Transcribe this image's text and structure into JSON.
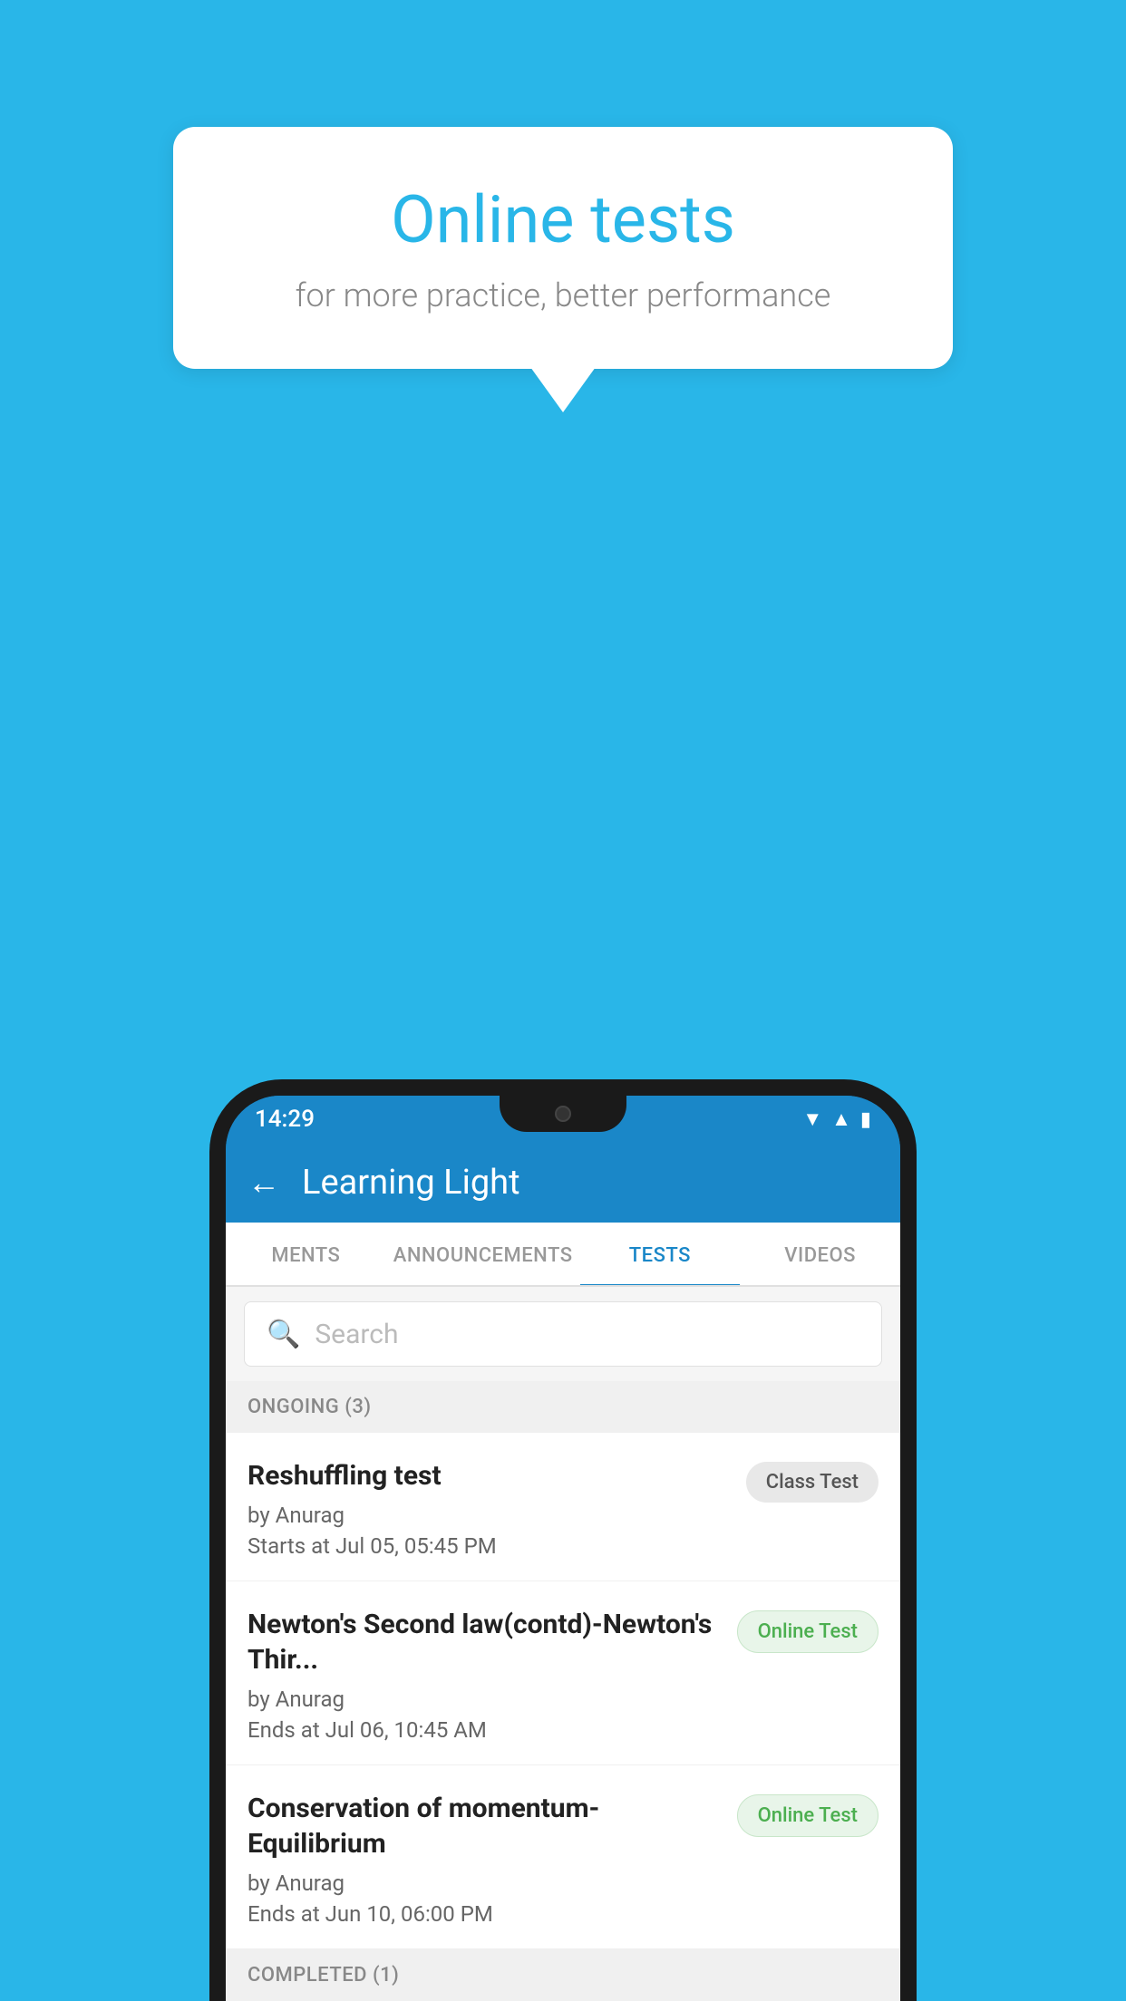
{
  "background_color": "#29b6e8",
  "speech_bubble": {
    "title": "Online tests",
    "subtitle": "for more practice, better performance"
  },
  "status_bar": {
    "time": "14:29",
    "icons": [
      "wifi",
      "signal",
      "battery"
    ]
  },
  "app": {
    "title": "Learning Light",
    "back_label": "←"
  },
  "tabs": [
    {
      "label": "MENTS",
      "active": false
    },
    {
      "label": "ANNOUNCEMENTS",
      "active": false
    },
    {
      "label": "TESTS",
      "active": true
    },
    {
      "label": "VIDEOS",
      "active": false
    }
  ],
  "search": {
    "placeholder": "Search"
  },
  "ongoing_section": {
    "title": "ONGOING (3)"
  },
  "tests": [
    {
      "name": "Reshuffling test",
      "author": "by Anurag",
      "time_label": "Starts at",
      "time": "Jul 05, 05:45 PM",
      "badge": "Class Test",
      "badge_type": "class"
    },
    {
      "name": "Newton's Second law(contd)-Newton's Thir...",
      "author": "by Anurag",
      "time_label": "Ends at",
      "time": "Jul 06, 10:45 AM",
      "badge": "Online Test",
      "badge_type": "online"
    },
    {
      "name": "Conservation of momentum-Equilibrium",
      "author": "by Anurag",
      "time_label": "Ends at",
      "time": "Jun 10, 06:00 PM",
      "badge": "Online Test",
      "badge_type": "online"
    }
  ],
  "completed_section": {
    "title": "COMPLETED (1)"
  }
}
